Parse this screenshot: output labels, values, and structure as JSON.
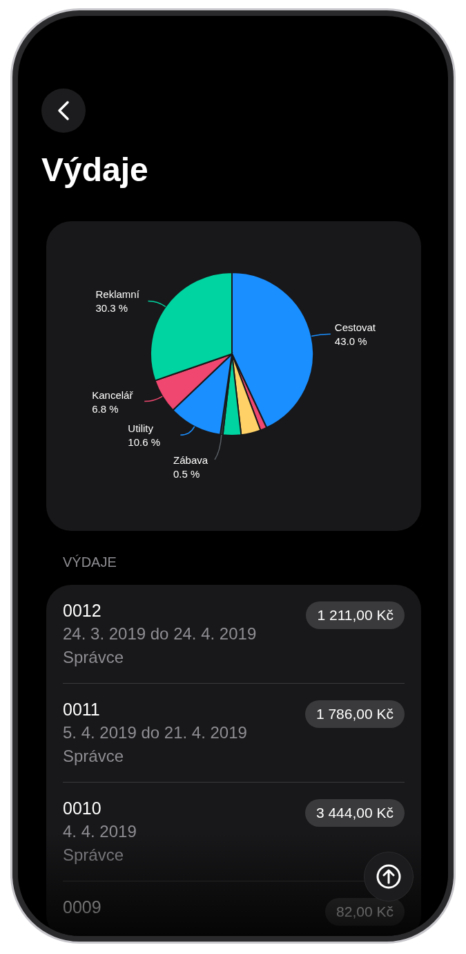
{
  "header": {
    "title": "Výdaje"
  },
  "chart": {
    "chart_data": {
      "type": "pie",
      "categories": [
        "Cestovat",
        null,
        null,
        null,
        "Zábava",
        "Utility",
        "Kancelář",
        "Reklamní"
      ],
      "values": [
        43.0,
        1.3,
        3.9,
        3.6,
        0.5,
        10.6,
        6.8,
        30.3
      ],
      "colors": [
        "#1a8fff",
        "#ef476f",
        "#ffd166",
        "#00d4a0",
        "#3a3f44",
        "#1a8fff",
        "#ef476f",
        "#00d4a0"
      ],
      "value_labels": [
        "43.0 %",
        null,
        null,
        null,
        "0.5 %",
        "10.6 %",
        "6.8 %",
        "30.3 %"
      ]
    }
  },
  "section_header": "VÝDAJE",
  "expenses": [
    {
      "number": "0012",
      "dates": "24. 3. 2019 do 24. 4. 2019",
      "owner": "Správce",
      "amount": "1 211,00 Kč"
    },
    {
      "number": "0011",
      "dates": "5. 4. 2019 do 21. 4. 2019",
      "owner": "Správce",
      "amount": "1 786,00 Kč"
    },
    {
      "number": "0010",
      "dates": "4. 4. 2019",
      "owner": "Správce",
      "amount": "3 444,00 Kč"
    },
    {
      "number": "0009",
      "amount": "82,00 Kč"
    }
  ]
}
